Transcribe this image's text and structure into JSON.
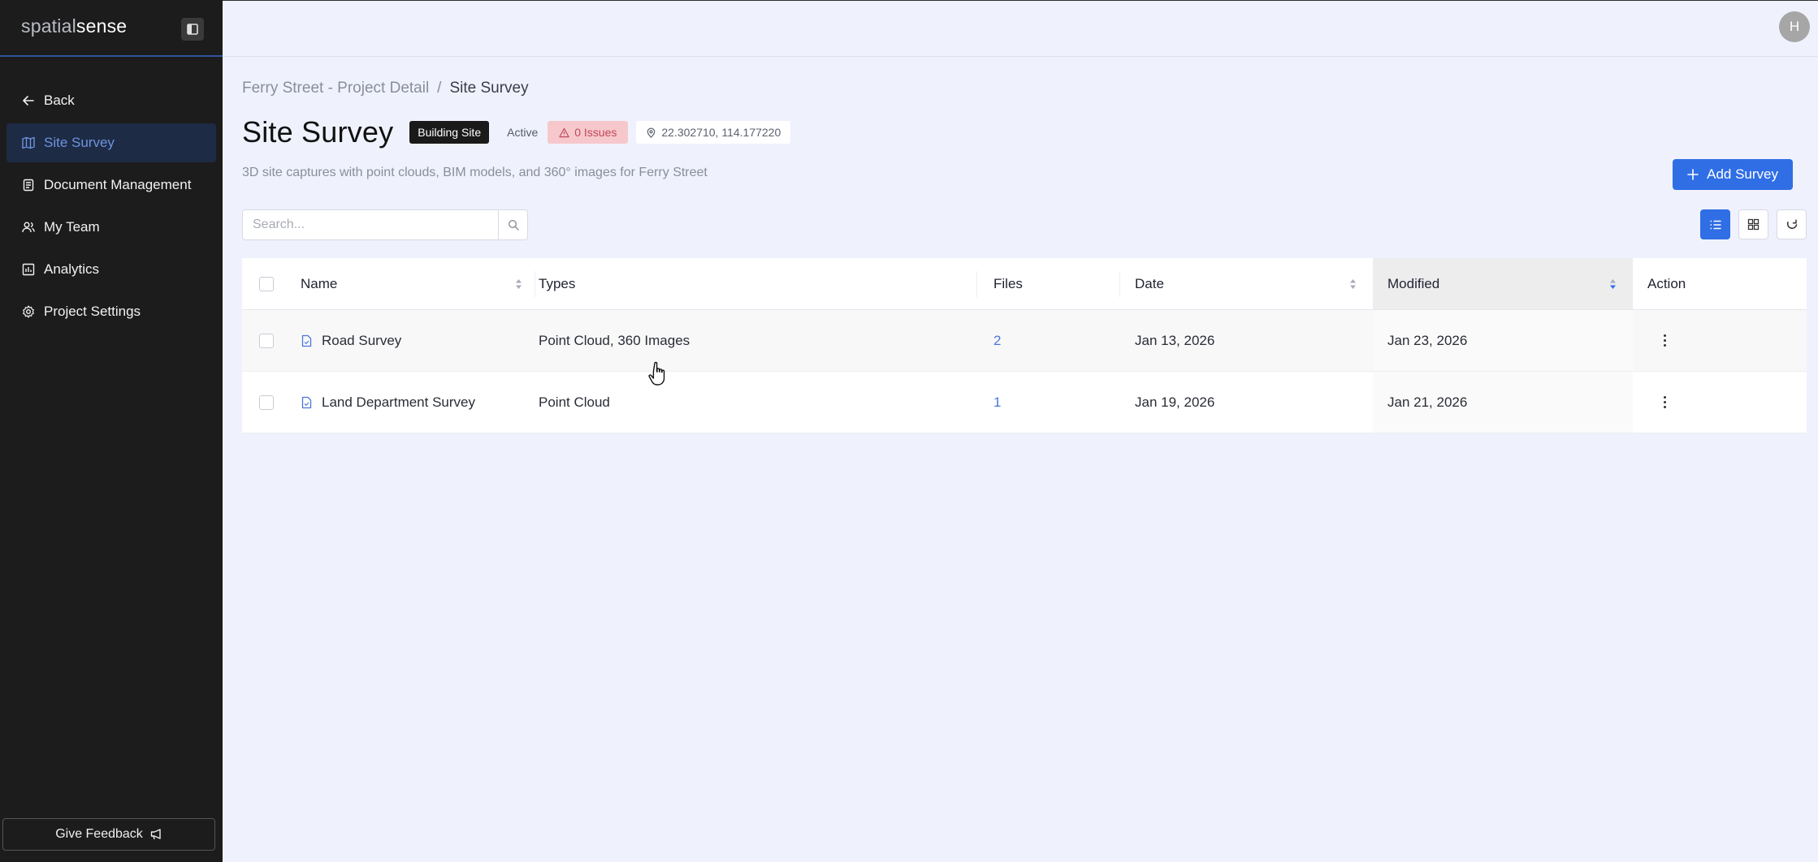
{
  "brand": {
    "part1": "spatial",
    "part2": "sense"
  },
  "sidebar": {
    "items": [
      {
        "label": "Back",
        "icon": "arrow-left-icon"
      },
      {
        "label": "Site Survey",
        "icon": "map-icon",
        "active": true
      },
      {
        "label": "Document Management",
        "icon": "document-icon"
      },
      {
        "label": "My Team",
        "icon": "users-icon"
      },
      {
        "label": "Analytics",
        "icon": "analytics-icon"
      },
      {
        "label": "Project Settings",
        "icon": "gear-icon"
      }
    ],
    "feedback_label": "Give Feedback"
  },
  "header": {
    "avatar_initial": "H"
  },
  "breadcrumb": {
    "parent": "Ferry Street - Project Detail",
    "separator": "/",
    "current": "Site Survey"
  },
  "page": {
    "title": "Site Survey",
    "type_badge": "Building Site",
    "status": "Active",
    "issues": "0 Issues",
    "coords": "22.302710, 114.177220",
    "subtitle": "3D site captures with point clouds, BIM models, and 360° images for Ferry Street",
    "add_button": "Add Survey"
  },
  "search": {
    "placeholder": "Search..."
  },
  "table": {
    "headers": {
      "name": "Name",
      "types": "Types",
      "files": "Files",
      "date": "Date",
      "modified": "Modified",
      "action": "Action"
    },
    "rows": [
      {
        "name": "Road Survey",
        "types": "Point Cloud, 360 Images",
        "files": "2",
        "date": "Jan 13, 2026",
        "modified": "Jan 23, 2026"
      },
      {
        "name": "Land Department Survey",
        "types": "Point Cloud",
        "files": "1",
        "date": "Jan 19, 2026",
        "modified": "Jan 21, 2026"
      }
    ]
  },
  "colors": {
    "accent": "#2f6ee5",
    "sidebar_bg": "#1c1c1c",
    "page_bg": "#eff2fd",
    "issues_bg": "#f6c8cc"
  }
}
